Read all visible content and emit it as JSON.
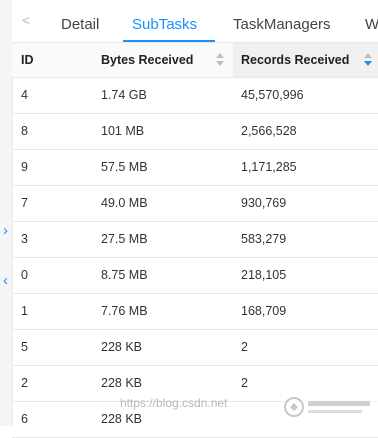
{
  "tabs": {
    "items": [
      {
        "label": "Detail"
      },
      {
        "label": "SubTasks"
      },
      {
        "label": "TaskManagers"
      },
      {
        "label": "W"
      }
    ],
    "active": "SubTasks"
  },
  "side_arrows": [
    "›",
    "‹"
  ],
  "table": {
    "columns": {
      "id": "ID",
      "bytes": "Bytes Received",
      "records": "Records Received"
    },
    "sorted_by": "Records Received",
    "sort_order": "descending",
    "rows": [
      {
        "id": "4",
        "bytes": "1.74 GB",
        "records": "45,570,996"
      },
      {
        "id": "8",
        "bytes": "101 MB",
        "records": "2,566,528"
      },
      {
        "id": "9",
        "bytes": "57.5 MB",
        "records": "1,171,285"
      },
      {
        "id": "7",
        "bytes": "49.0 MB",
        "records": "930,769"
      },
      {
        "id": "3",
        "bytes": "27.5 MB",
        "records": "583,279"
      },
      {
        "id": "0",
        "bytes": "8.75 MB",
        "records": "218,105"
      },
      {
        "id": "1",
        "bytes": "7.76 MB",
        "records": "168,709"
      },
      {
        "id": "5",
        "bytes": "228 KB",
        "records": "2"
      },
      {
        "id": "2",
        "bytes": "228 KB",
        "records": "2"
      },
      {
        "id": "6",
        "bytes": "228 KB",
        "records": ""
      }
    ]
  },
  "colors": {
    "accent": "#1890ff",
    "border": "#e8e8e8",
    "header_bg": "#fafafa",
    "sorted_header_bg": "#f0f0f0"
  },
  "watermark": "https://blog.csdn.net"
}
